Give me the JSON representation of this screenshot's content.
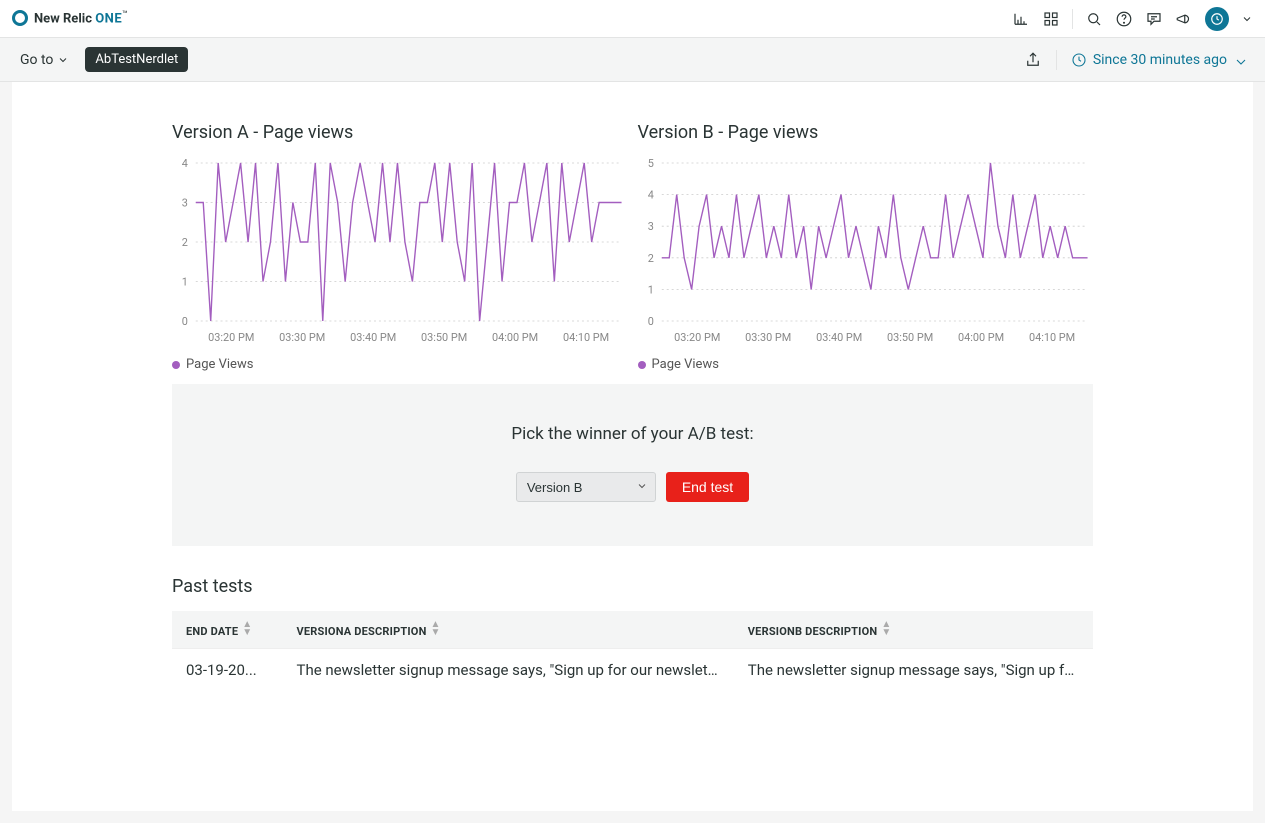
{
  "brand": {
    "name": "New Relic",
    "suffix": "ONE",
    "tm": "™"
  },
  "goto_label": "Go to",
  "nerdlet_name": "AbTestNerdlet",
  "timerange_label": "Since 30 minutes ago",
  "chart_a_title": "Version A - Page views",
  "chart_b_title": "Version B - Page views",
  "legend_label": "Page Views",
  "winner": {
    "title": "Pick the winner of your A/B test:",
    "selected": "Version B",
    "button": "End test"
  },
  "past_tests": {
    "title": "Past tests",
    "headers": {
      "end_date": "END DATE",
      "va": "VERSIONA DESCRIPTION",
      "vb": "VERSIONB DESCRIPTION"
    },
    "rows": [
      {
        "end_date": "03-19-20...",
        "va": "The newsletter signup message says, \"Sign up for our newslette...",
        "vb": "The newsletter signup message says, \"Sign up for our n"
      }
    ]
  },
  "chart_data": [
    {
      "id": "A",
      "type": "line",
      "title": "Version A - Page views",
      "ylabel": "",
      "xlabel": "",
      "ylim": [
        0,
        4
      ],
      "yticks": [
        0,
        1,
        2,
        3,
        4
      ],
      "xticks": [
        "03:20 PM",
        "03:30 PM",
        "03:40 PM",
        "03:50 PM",
        "04:00 PM",
        "04:10 PM"
      ],
      "series": [
        {
          "name": "Page Views",
          "color": "#a35ebf",
          "values": [
            3,
            3,
            0,
            4,
            2,
            3,
            4,
            2,
            4,
            1,
            2,
            4,
            1,
            3,
            2,
            2,
            4,
            0,
            4,
            3,
            1,
            3,
            4,
            3,
            2,
            4,
            2,
            4,
            2,
            1,
            3,
            3,
            4,
            2,
            4,
            2,
            1,
            4,
            0,
            2,
            4,
            1,
            3,
            3,
            4,
            2,
            3,
            4,
            1,
            4,
            2,
            3,
            4,
            2,
            3,
            3,
            3,
            3
          ]
        }
      ]
    },
    {
      "id": "B",
      "type": "line",
      "title": "Version B - Page views",
      "ylabel": "",
      "xlabel": "",
      "ylim": [
        0,
        5
      ],
      "yticks": [
        0,
        1,
        2,
        3,
        4,
        5
      ],
      "xticks": [
        "03:20 PM",
        "03:30 PM",
        "03:40 PM",
        "03:50 PM",
        "04:00 PM",
        "04:10 PM"
      ],
      "series": [
        {
          "name": "Page Views",
          "color": "#a35ebf",
          "values": [
            2,
            2,
            4,
            2,
            1,
            3,
            4,
            2,
            3,
            2,
            4,
            2,
            3,
            4,
            2,
            3,
            2,
            4,
            2,
            3,
            1,
            3,
            2,
            3,
            4,
            2,
            3,
            2,
            1,
            3,
            2,
            4,
            2,
            1,
            2,
            3,
            2,
            2,
            4,
            2,
            3,
            4,
            3,
            2,
            5,
            3,
            2,
            4,
            2,
            3,
            4,
            2,
            3,
            2,
            3,
            2,
            2,
            2
          ]
        }
      ]
    }
  ]
}
